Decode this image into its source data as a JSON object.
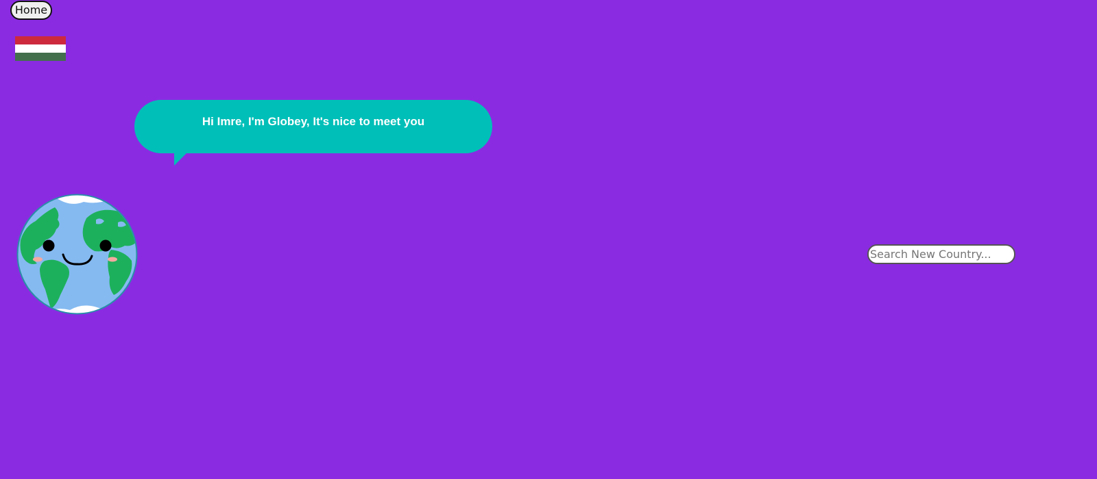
{
  "nav": {
    "home_label": "Home"
  },
  "flag": {
    "icon": "hungary-flag-icon",
    "colors": [
      "#cd2a3e",
      "#ffffff",
      "#436f4d"
    ]
  },
  "speech_bubble": {
    "text": "Hi Imre, I'm Globey, It's nice to meet you",
    "background": "#00bfb8"
  },
  "mascot": {
    "icon": "globe-mascot-icon"
  },
  "search": {
    "placeholder": "Search New Country...",
    "value": ""
  },
  "theme": {
    "background": "#8a2be2"
  }
}
